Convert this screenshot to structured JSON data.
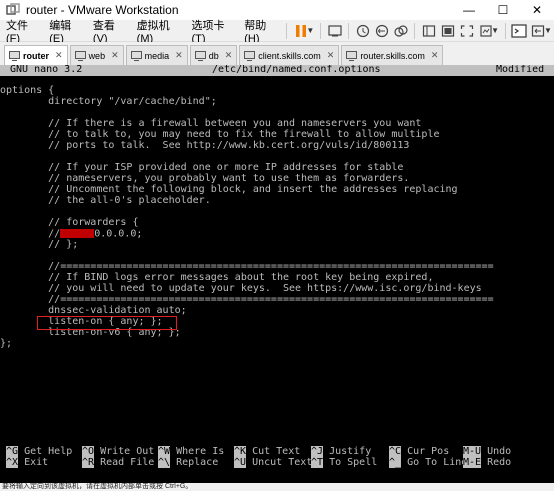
{
  "window": {
    "title": "router - VMware Workstation",
    "minimize": "—",
    "maximize": "☐",
    "close": "✕"
  },
  "menu": {
    "items": [
      "文件(F)",
      "编辑(E)",
      "查看(V)",
      "虚拟机(M)",
      "选项卡(T)",
      "帮助(H)"
    ]
  },
  "tabs": [
    {
      "label": "router",
      "active": true
    },
    {
      "label": "web"
    },
    {
      "label": "media"
    },
    {
      "label": "db"
    },
    {
      "label": "client.skills.com"
    },
    {
      "label": "router.skills.com"
    }
  ],
  "nano": {
    "version": "GNU nano 3.2",
    "filename": "/etc/bind/named.conf.options",
    "status": "Modified"
  },
  "file_lines": [
    "options {",
    "        directory \"/var/cache/bind\";",
    "",
    "        // If there is a firewall between you and nameservers you want",
    "        // to talk to, you may need to fix the firewall to allow multiple",
    "        // ports to talk.  See http://www.kb.cert.org/vuls/id/800113",
    "",
    "        // If your ISP provided one or more IP addresses for stable",
    "        // nameservers, you probably want to use them as forwarders.",
    "        // Uncomment the following block, and insert the addresses replacing",
    "        // the all-0's placeholder.",
    "",
    "        // forwarders {",
    "        //      0.0.0.0;",
    "        // };",
    "",
    "        //========================================================================",
    "        // If BIND logs error messages about the root key being expired,",
    "        // you will need to update your keys.  See https://www.isc.org/bind-keys",
    "        //========================================================================",
    "        dnssec-validation auto;",
    "        listen-on { any; };",
    "        listen-on-v6 { any; };",
    "};"
  ],
  "redacted_line_index": 13,
  "shortcuts": [
    [
      {
        "key": "^G",
        "label": "Get Help"
      },
      {
        "key": "^O",
        "label": "Write Out"
      },
      {
        "key": "^W",
        "label": "Where Is"
      },
      {
        "key": "^K",
        "label": "Cut Text"
      },
      {
        "key": "^J",
        "label": "Justify"
      },
      {
        "key": "^C",
        "label": "Cur Pos"
      },
      {
        "key": "M-U",
        "label": "Undo"
      }
    ],
    [
      {
        "key": "^X",
        "label": "Exit"
      },
      {
        "key": "^R",
        "label": "Read File"
      },
      {
        "key": "^\\",
        "label": "Replace"
      },
      {
        "key": "^U",
        "label": "Uncut Text"
      },
      {
        "key": "^T",
        "label": "To Spell"
      },
      {
        "key": "^_",
        "label": "Go To Line"
      },
      {
        "key": "M-E",
        "label": "Redo"
      }
    ]
  ],
  "statusbar": {
    "text": "要将输入定向到该虚拟机，请在虚拟机内部单击或按 Ctrl+G。"
  },
  "colors": {
    "terminal_bg": "#000000",
    "terminal_fg": "#bcbcbc",
    "nano_bar": "#c0c0c0",
    "pause_orange": "#f07d00",
    "highlight_red": "#e02020"
  }
}
